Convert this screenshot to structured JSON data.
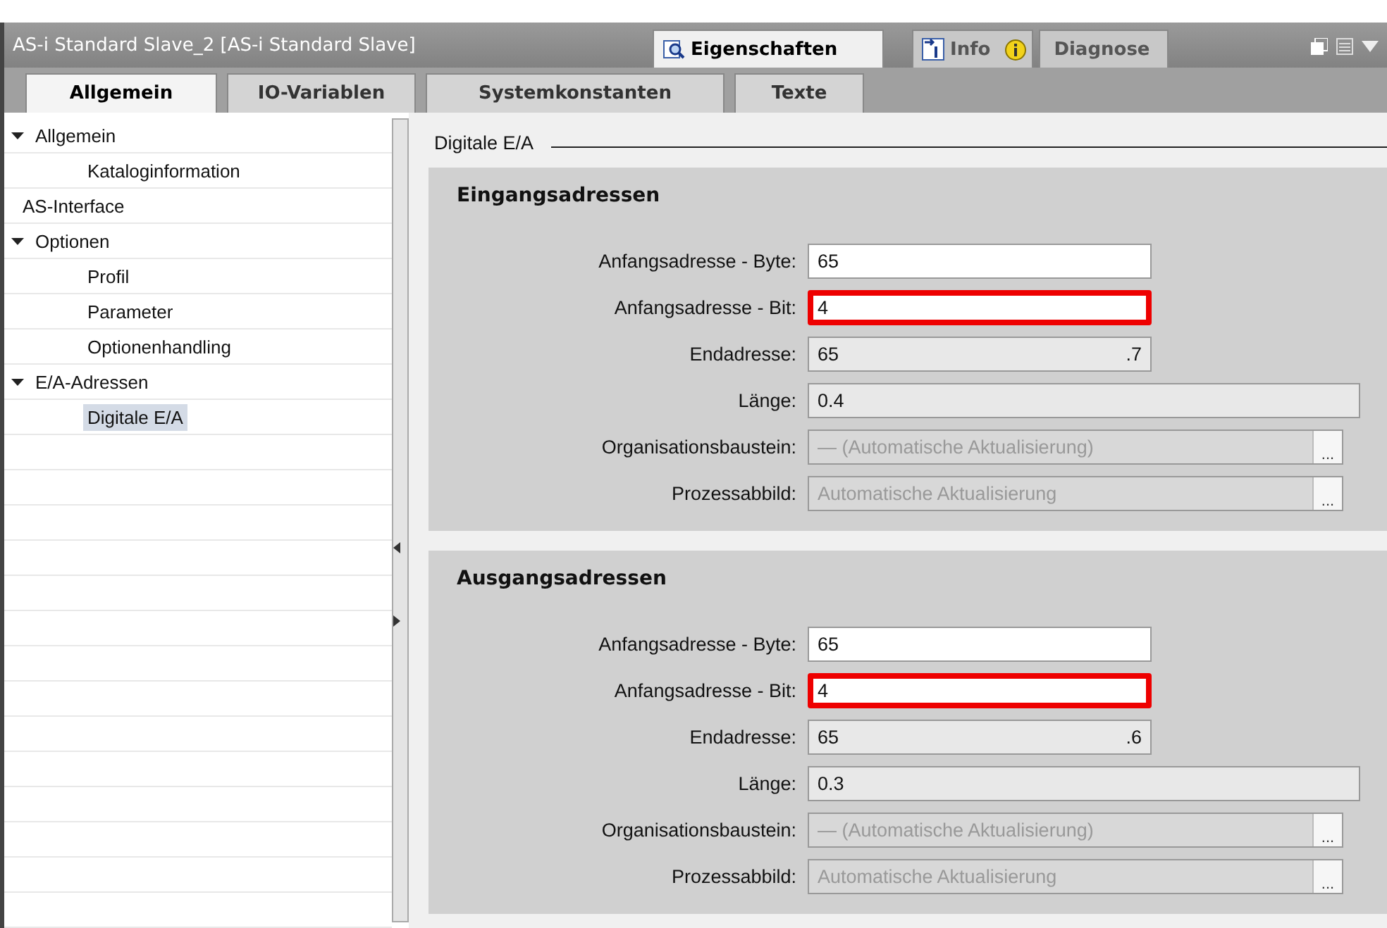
{
  "panel_title": "AS-i Standard Slave_2 [AS-i Standard Slave]",
  "view_tabs": [
    {
      "label": "Eigenschaften",
      "selected": true,
      "kind": "properties"
    },
    {
      "label": "Info",
      "selected": false,
      "kind": "info"
    },
    {
      "label": "Diagnose",
      "selected": false,
      "kind": "diagnostics"
    }
  ],
  "tabs": [
    {
      "label": "Allgemein",
      "selected": true
    },
    {
      "label": "IO-Variablen",
      "selected": false
    },
    {
      "label": "Systemkonstanten",
      "selected": false
    },
    {
      "label": "Texte",
      "selected": false
    }
  ],
  "tree": [
    {
      "label": "Allgemein",
      "expanded": true,
      "selected": false,
      "children": [
        {
          "label": "Kataloginformation",
          "selected": false
        }
      ]
    },
    {
      "label": "AS-Interface",
      "selected": false
    },
    {
      "label": "Optionen",
      "expanded": true,
      "selected": false,
      "children": [
        {
          "label": "Profil",
          "selected": false
        },
        {
          "label": "Parameter",
          "selected": false
        },
        {
          "label": "Optionenhandling",
          "selected": false
        }
      ]
    },
    {
      "label": "E/A-Adressen",
      "expanded": true,
      "selected": false,
      "children": [
        {
          "label": "Digitale E/A",
          "selected": true
        }
      ]
    }
  ],
  "section_title": "Digitale E/A",
  "groups": [
    {
      "title": "Eingangsadressen",
      "fields": [
        {
          "label": "Anfangsadresse - Byte:",
          "kind": "input",
          "value": "65",
          "highlighted": false
        },
        {
          "label": "Anfangsadresse - Bit:",
          "kind": "input",
          "value": "4",
          "highlighted": true
        },
        {
          "label": "Endadresse:",
          "kind": "readonly",
          "value": "65",
          "suffix": ".7"
        },
        {
          "label": "Länge:",
          "kind": "wide",
          "value": "0.4"
        },
        {
          "label": "Organisationsbaustein:",
          "kind": "picker",
          "value": "— (Automatische Aktualisierung)",
          "button": "..."
        },
        {
          "label": "Prozessabbild:",
          "kind": "picker",
          "value": "Automatische Aktualisierung",
          "button": "..."
        }
      ]
    },
    {
      "title": "Ausgangsadressen",
      "fields": [
        {
          "label": "Anfangsadresse - Byte:",
          "kind": "input",
          "value": "65",
          "highlighted": false
        },
        {
          "label": "Anfangsadresse - Bit:",
          "kind": "input",
          "value": "4",
          "highlighted": true
        },
        {
          "label": "Endadresse:",
          "kind": "readonly",
          "value": "65",
          "suffix": ".6"
        },
        {
          "label": "Länge:",
          "kind": "wide",
          "value": "0.3"
        },
        {
          "label": "Organisationsbaustein:",
          "kind": "picker",
          "value": "— (Automatische Aktualisierung)",
          "button": "..."
        },
        {
          "label": "Prozessabbild:",
          "kind": "picker",
          "value": "Automatische Aktualisierung",
          "button": "..."
        }
      ]
    }
  ]
}
